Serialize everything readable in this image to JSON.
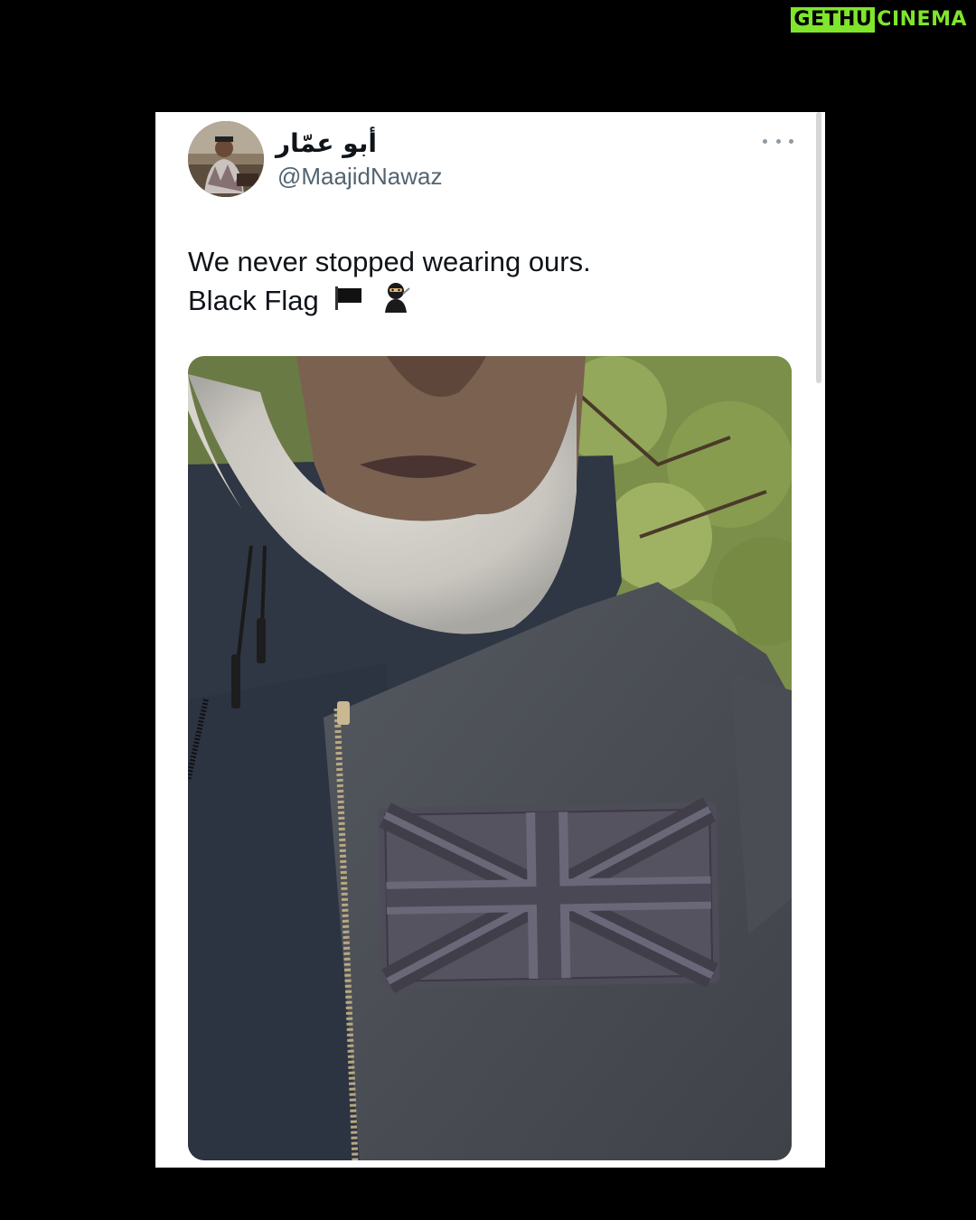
{
  "watermark": {
    "left": "GETHU",
    "right": "CINEMA",
    "color": "#7fe62b"
  },
  "tweet": {
    "display_name": "أبو عمّار",
    "handle": "@MaajidNawaz",
    "text_line1": "We never stopped wearing ours.",
    "text_line2": "Black Flag",
    "emojis": [
      "black-flag-icon",
      "ninja-icon"
    ]
  },
  "colors": {
    "background": "#000000",
    "card": "#ffffff",
    "text": "#0f1419",
    "secondary": "#536471"
  }
}
